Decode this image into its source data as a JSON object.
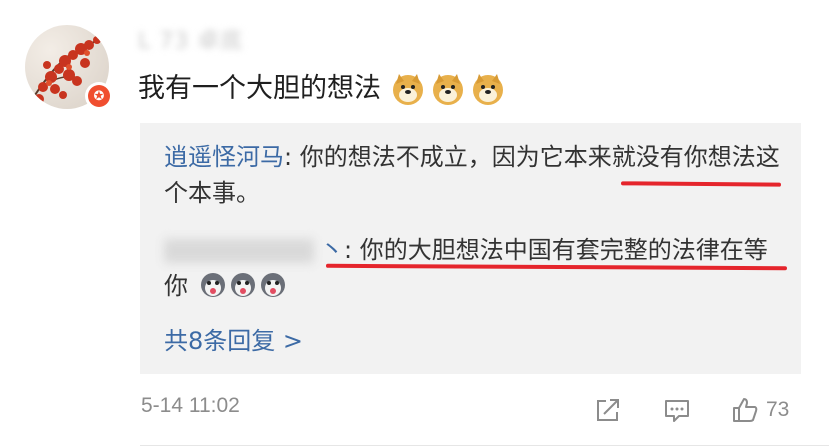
{
  "comment": {
    "username": "L 73 卓底",
    "text": "我有一个大胆的想法",
    "reaction_icons": [
      "doge-emoji",
      "doge-emoji",
      "doge-emoji"
    ],
    "timestamp": "5-14 11:02",
    "like_count": "73"
  },
  "replies": [
    {
      "author": "逍遥怪河马",
      "separator": ": ",
      "text": "你的想法不成立，因为它本来就没有你想法这个本事。"
    },
    {
      "author_suffix": "丶",
      "separator": ": ",
      "text": "你的大胆想法中国有套完整的法律在等你",
      "emojis": [
        "husky-emoji",
        "husky-emoji",
        "husky-emoji"
      ]
    }
  ],
  "more_replies_label": "共8条回复 >",
  "colors": {
    "link": "#3c6aa5",
    "underline": "#e5252c",
    "reply_bg": "#f2f2f2",
    "badge": "#f04e2f"
  }
}
